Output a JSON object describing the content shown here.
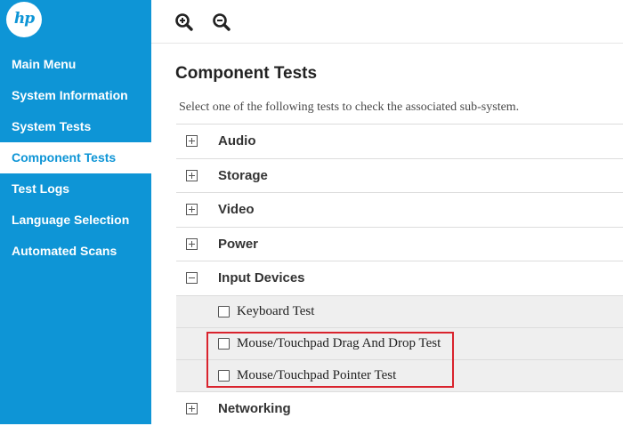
{
  "logo": {
    "text": "hp"
  },
  "sidebar": {
    "items": [
      {
        "label": "Main Menu",
        "active": false
      },
      {
        "label": "System Information",
        "active": false
      },
      {
        "label": "System Tests",
        "active": false
      },
      {
        "label": "Component Tests",
        "active": true
      },
      {
        "label": "Test Logs",
        "active": false
      },
      {
        "label": "Language Selection",
        "active": false
      },
      {
        "label": "Automated Scans",
        "active": false
      }
    ]
  },
  "toolbar": {
    "zoom_in_icon": "zoom-in-icon",
    "zoom_out_icon": "zoom-out-icon"
  },
  "main": {
    "title": "Component Tests",
    "subtitle": "Select one of the following tests to check the associated sub-system.",
    "categories": [
      {
        "label": "Audio",
        "expanded": false
      },
      {
        "label": "Storage",
        "expanded": false
      },
      {
        "label": "Video",
        "expanded": false
      },
      {
        "label": "Power",
        "expanded": false
      },
      {
        "label": "Input Devices",
        "expanded": true,
        "tests": [
          {
            "label": "Keyboard Test",
            "checked": false
          },
          {
            "label": "Mouse/Touchpad Drag And Drop Test",
            "checked": false
          },
          {
            "label": "Mouse/Touchpad Pointer Test",
            "checked": false
          }
        ]
      },
      {
        "label": "Networking",
        "expanded": false
      }
    ]
  },
  "colors": {
    "sidebar": "#0e95d6",
    "highlight": "#d9232d",
    "subrow": "#efefef"
  }
}
